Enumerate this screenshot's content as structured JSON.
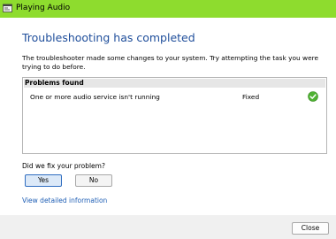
{
  "window": {
    "title": "Playing Audio",
    "titlebar_color": "#8edc2e",
    "app_icon": "troubleshooter-icon"
  },
  "heading": "Troubleshooting has completed",
  "description": "The troubleshooter made some changes to your system. Try attempting the task you were trying to do before.",
  "problems": {
    "header": "Problems found",
    "rows": [
      {
        "name": "One or more audio service isn't running",
        "status": "Fixed",
        "status_icon": "green-check-icon"
      }
    ]
  },
  "feedback": {
    "question": "Did we fix your problem?",
    "yes_label": "Yes",
    "no_label": "No"
  },
  "details_link": "View detailed information",
  "footer": {
    "close_label": "Close"
  },
  "colors": {
    "heading": "#1f4e9b",
    "link": "#1f5fb5",
    "selected_button": "#2f6dc0",
    "check": "#4fb233"
  }
}
